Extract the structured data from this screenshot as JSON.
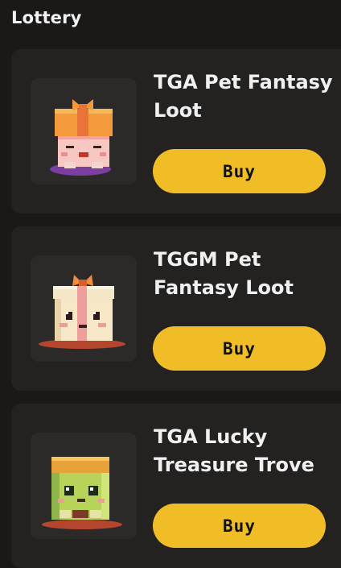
{
  "header": {
    "title": "Lottery"
  },
  "items": [
    {
      "title": "TGA Pet Fantasy Loot",
      "button_label": "Buy",
      "icon": "orange-gift-box-pet-icon"
    },
    {
      "title": "TGGM Pet Fantasy Loot",
      "button_label": "Buy",
      "icon": "cream-gift-box-pet-icon"
    },
    {
      "title": "TGA Lucky Treasure Trove",
      "button_label": "Buy",
      "icon": "green-treasure-box-pet-icon"
    }
  ],
  "colors": {
    "background": "#1b1918",
    "card": "#242221",
    "thumb": "#2c2a29",
    "button": "#f0bd27",
    "button_text": "#111111"
  }
}
